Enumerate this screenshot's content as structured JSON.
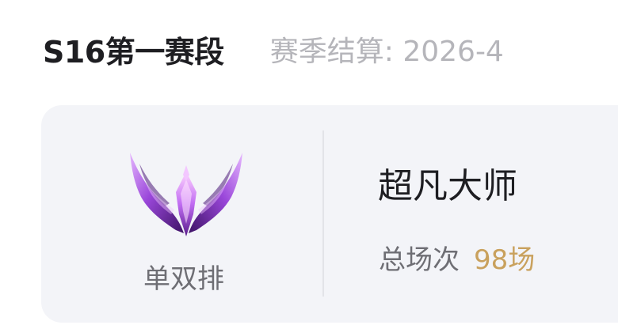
{
  "header": {
    "season_title": "S16第一赛段",
    "settle_text": "赛季结算: 2026-4"
  },
  "rank_card": {
    "emblem_icon": "master-tier-wings-emblem",
    "queue_label": "单双排",
    "rank_name": "超凡大师",
    "games_label": "总场次",
    "games_value": "98场"
  },
  "colors": {
    "title": "#1e1e22",
    "muted": "#b5b5ba",
    "card_bg": "#f3f4f8",
    "gold": "#c9a15d",
    "emblem_purple": "#8a3fd1"
  }
}
